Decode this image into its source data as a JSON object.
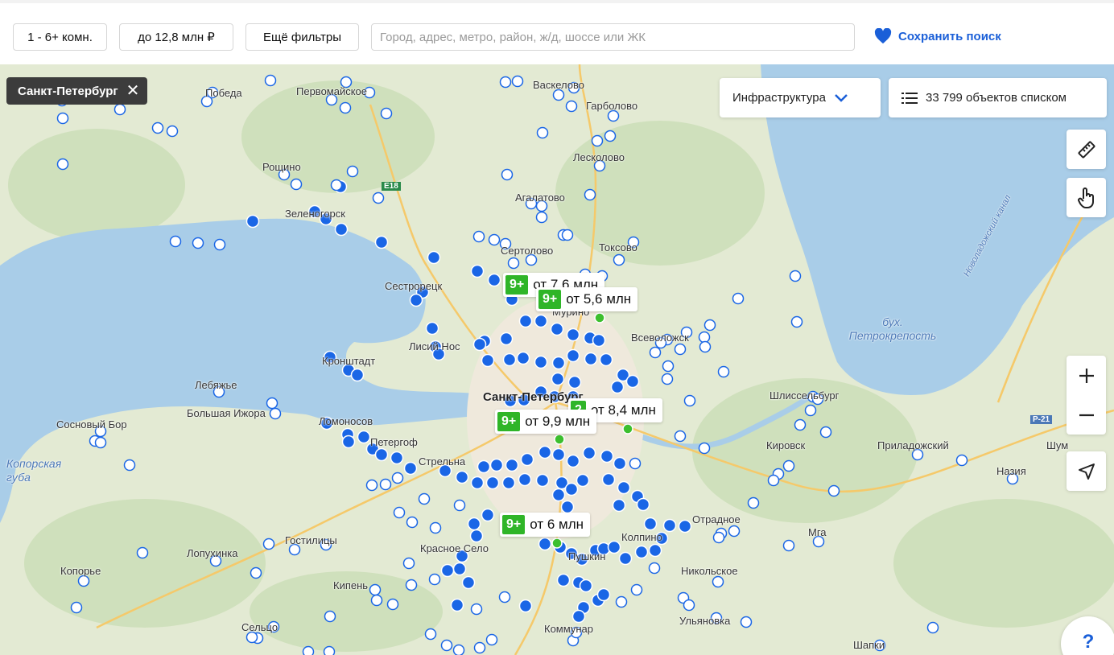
{
  "toolbar": {
    "rooms": "1 - 6+ комн.",
    "price": "до 12,8 млн ₽",
    "more_filters": "Ещё фильтры",
    "search_placeholder": "Город, адрес, метро, район, ж/д, шоссе или ЖК",
    "save_search": "Сохранить поиск"
  },
  "map": {
    "city_chip": "Санкт-Петербург",
    "infrastructure": "Инфраструктура",
    "list_button": "33 799 объектов списком",
    "help": "?",
    "price_tags": [
      {
        "count": "9+",
        "text": "от 7,6 млн"
      },
      {
        "count": "9+",
        "text": "от 5,6 млн"
      },
      {
        "count": "2",
        "text": "от 8,4 млн"
      },
      {
        "count": "9+",
        "text": "от 9,9 млн"
      },
      {
        "count": "9+",
        "text": "от 6 млн"
      }
    ],
    "places": [
      "Победа",
      "Первомайское",
      "Васкелово",
      "Гарболово",
      "Рощино",
      "Лесколово",
      "Агалатово",
      "Зеленогорск",
      "Сертолово",
      "Токсово",
      "Сестрорецк",
      "Мурино",
      "Всеволожск",
      "Лисий Нос",
      "Кронштадт",
      "Лебяжье",
      "Санкт-Петербург",
      "Шлиссельбург",
      "Сосновый Бор",
      "Большая Ижора",
      "Ломоносов",
      "Петергоф",
      "Стрельна",
      "Кировск",
      "Приладожский",
      "Шум",
      "Назия",
      "Пушкин",
      "Колпино",
      "Отрадное",
      "Мга",
      "Гостилицы",
      "Лопухинка",
      "Красное Село",
      "Копорье",
      "Никольское",
      "Кипень",
      "Коммунар",
      "Ульяновка",
      "Сельцо",
      "Шапки",
      "E18",
      "Р-21"
    ],
    "water": [
      "Копорская губа",
      "бух. Петрокрепость",
      "Новоладожский канал"
    ],
    "colors": {
      "water": "#a9cde8",
      "land": "#e6ecd8",
      "city": "#f2efe7",
      "dot": "#1a66e6",
      "tag_green": "#2fb528",
      "accent": "#1a5fd8"
    }
  }
}
